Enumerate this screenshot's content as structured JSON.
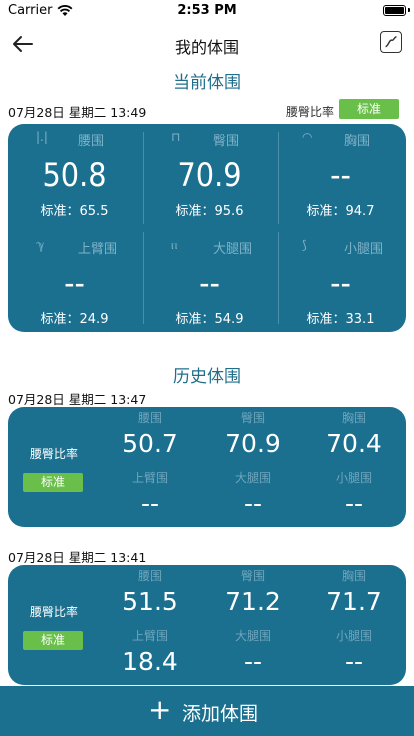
{
  "status_bar": {
    "carrier": "Carrier",
    "time": "2:53 PM"
  },
  "nav": {
    "title": "我的体围"
  },
  "current": {
    "section_title": "当前体围",
    "date": "07月28日  星期二 13:49",
    "ratio_label": "腰臀比率",
    "ratio_badge": "标准",
    "cells": [
      {
        "label": "腰围",
        "icon": "waist-icon",
        "value": "50.8",
        "std": "标准：65.5"
      },
      {
        "label": "臀围",
        "icon": "hip-icon",
        "value": "70.9",
        "std": "标准：95.6"
      },
      {
        "label": "胸围",
        "icon": "chest-icon",
        "value": "--",
        "std": "标准：94.7"
      },
      {
        "label": "上臂围",
        "icon": "arm-icon",
        "value": "--",
        "std": "标准：24.9"
      },
      {
        "label": "大腿围",
        "icon": "thigh-icon",
        "value": "--",
        "std": "标准：54.9"
      },
      {
        "label": "小腿围",
        "icon": "calf-icon",
        "value": "--",
        "std": "标准：33.1"
      }
    ]
  },
  "history": {
    "section_title": "历史体围",
    "records": [
      {
        "date": "07月28日  星期二 13:47",
        "ratio_label": "腰臀比率",
        "ratio_badge": "标准",
        "cells": [
          {
            "label": "腰围",
            "value": "50.7"
          },
          {
            "label": "臀围",
            "value": "70.9"
          },
          {
            "label": "胸围",
            "value": "70.4"
          },
          {
            "label": "上臂围",
            "value": "--"
          },
          {
            "label": "大腿围",
            "value": "--"
          },
          {
            "label": "小腿围",
            "value": "--"
          }
        ]
      },
      {
        "date": "07月28日  星期二 13:41",
        "ratio_label": "腰臀比率",
        "ratio_badge": "标准",
        "cells": [
          {
            "label": "腰围",
            "value": "51.5"
          },
          {
            "label": "臀围",
            "value": "71.2"
          },
          {
            "label": "胸围",
            "value": "71.7"
          },
          {
            "label": "上臂围",
            "value": "18.4"
          },
          {
            "label": "大腿围",
            "value": "--"
          },
          {
            "label": "小腿围",
            "value": "--"
          }
        ]
      }
    ]
  },
  "add_button": {
    "label": "添加体围"
  },
  "colors": {
    "accent": "#1b6f8f",
    "badge": "#6abf4b",
    "title": "#1f6f8b"
  }
}
